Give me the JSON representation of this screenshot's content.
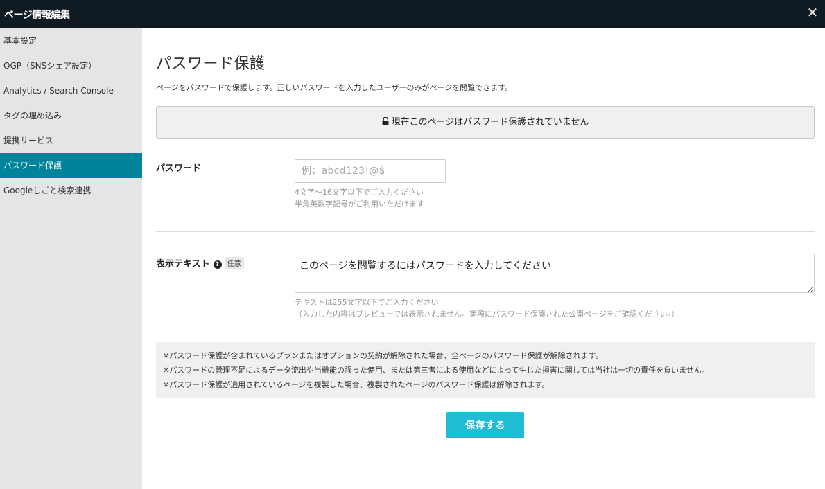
{
  "window": {
    "title": "ページ情報編集",
    "close_label": "✕"
  },
  "sidebar": {
    "items": [
      {
        "label": "基本設定",
        "active": false
      },
      {
        "label": "OGP（SNSシェア設定）",
        "active": false
      },
      {
        "label": "Analytics / Search Console",
        "active": false
      },
      {
        "label": "タグの埋め込み",
        "active": false
      },
      {
        "label": "提携サービス",
        "active": false
      },
      {
        "label": "パスワード保護",
        "active": true
      },
      {
        "label": "Googleしごと検索連携",
        "active": false
      }
    ]
  },
  "main": {
    "title": "パスワード保護",
    "description": "ページをパスワードで保護します。正しいパスワードを入力したユーザーのみがページを閲覧できます。",
    "status_text": "現在このページはパスワード保護されていません",
    "status_icon": "unlock-icon",
    "password": {
      "label": "パスワード",
      "value": "",
      "placeholder": "例：abcd123!@$",
      "hint_line1": "4文字〜16文字以下でご入力ください",
      "hint_line2": "半角英数字記号がご利用いただけます"
    },
    "display_text": {
      "label": "表示テキスト",
      "help_icon": "question-circle-icon",
      "optional_badge": "任意",
      "value": "このページを閲覧するにはパスワードを入力してください",
      "hint_line1": "テキストは255文字以下でご入力ください",
      "hint_line2": "（入力した内容はプレビューでは表示されません。実際にパスワード保護された公開ページをご確認ください。）"
    },
    "notices": [
      "※パスワード保護が含まれているプランまたはオプションの契約が解除された場合、全ページのパスワード保護が解除されます。",
      "※パスワードの管理不足によるデータ流出や当機能の誤った使用、または第三者による使用などによって生じた損害に関しては当社は一切の責任を負いません。",
      "※パスワード保護が適用されているページを複製した場合、複製されたページのパスワード保護は解除されます。"
    ],
    "save_label": "保存する"
  },
  "colors": {
    "topbar": "#0f1a22",
    "sidebar": "#e5e5e5",
    "sidebar_active": "#00849b",
    "save_button": "#1fbcd3"
  }
}
